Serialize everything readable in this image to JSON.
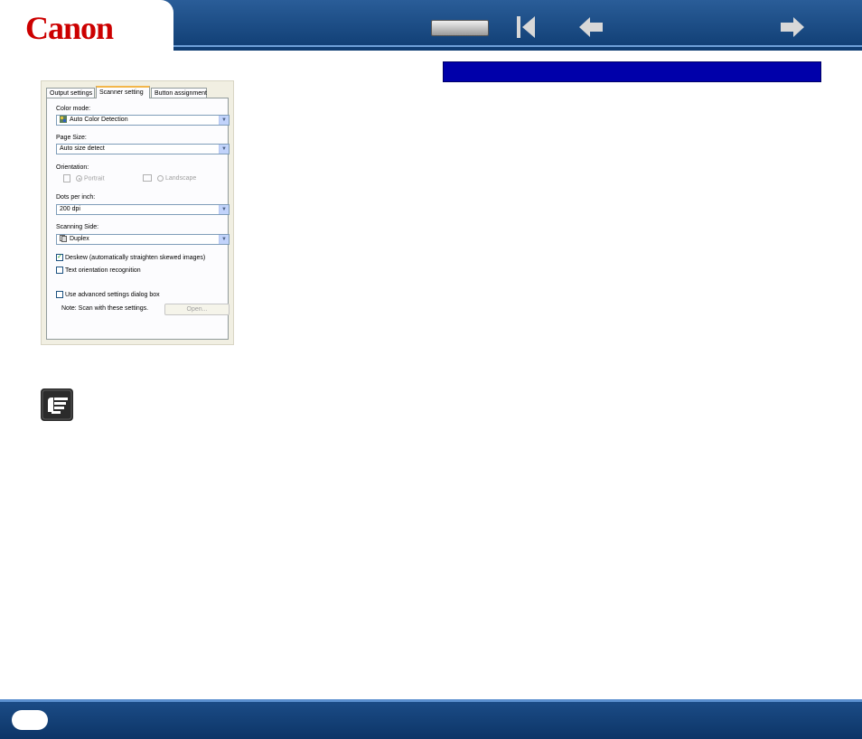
{
  "header": {
    "logo": "Canon"
  },
  "dialog": {
    "tabs": [
      {
        "label": "Output settings"
      },
      {
        "label": "Scanner setting"
      },
      {
        "label": "Button assignment"
      }
    ],
    "color_mode_label": "Color mode:",
    "color_mode_value": "Auto Color Detection",
    "page_size_label": "Page Size:",
    "page_size_value": "Auto size detect",
    "orientation_label": "Orientation:",
    "portrait_label": "Portrait",
    "landscape_label": "Landscape",
    "dpi_label": "Dots per inch:",
    "dpi_value": "200 dpi",
    "scanning_side_label": "Scanning Side:",
    "scanning_side_value": "Duplex",
    "deskew_label": "Deskew (automatically straighten skewed images)",
    "deskew_checked": true,
    "text_orientation_label": "Text orientation recognition",
    "advanced_label": "Use advanced settings dialog box",
    "note_text": "Note: Scan with these settings.",
    "open_button_label": "Open..."
  },
  "colors": {
    "header_blue": "#1a4a85",
    "section_bar": "#0000aa",
    "logo_red": "#cc0000"
  },
  "icons": {
    "nav_first": "first-page-icon",
    "nav_prev": "previous-page-icon",
    "nav_next": "next-page-icon",
    "note": "hint-pointing-hand-icon"
  }
}
